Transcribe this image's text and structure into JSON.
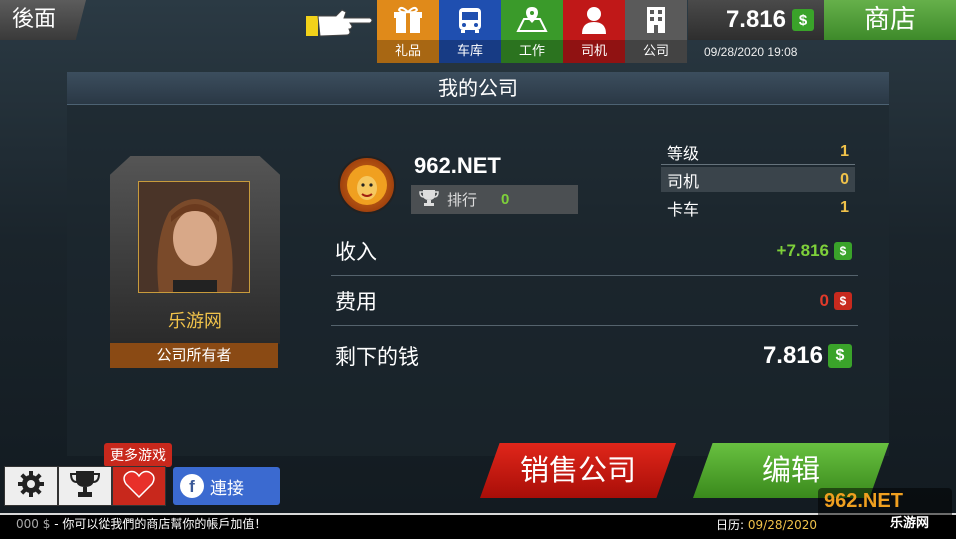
{
  "header": {
    "back_label": "後面",
    "tabs": [
      {
        "label": "礼品",
        "icon": "gift-icon",
        "color": "#e08a1a"
      },
      {
        "label": "车库",
        "icon": "bus-icon",
        "color": "#1f4fb0"
      },
      {
        "label": "工作",
        "icon": "map-icon",
        "color": "#3a9a2a"
      },
      {
        "label": "司机",
        "icon": "driver-icon",
        "color": "#c01818"
      },
      {
        "label": "公司",
        "icon": "building-icon",
        "color": "#5a5a5a"
      }
    ],
    "money": "7.816",
    "shop_label": "商店",
    "datetime": "09/28/2020 19:08"
  },
  "company": {
    "panel_title": "我的公司",
    "name": "962.NET",
    "rank_label": "排行",
    "rank_value": "0",
    "owner_name": "乐游网",
    "owner_role": "公司所有者",
    "stats": [
      {
        "label": "等级",
        "value": "1"
      },
      {
        "label": "司机",
        "value": "0"
      },
      {
        "label": "卡车",
        "value": "1"
      }
    ],
    "finance": [
      {
        "label": "收入",
        "value": "+7.816",
        "color": "#7ed03a",
        "currency_color": "#3aa32a"
      },
      {
        "label": "费用",
        "value": "0",
        "color": "#e03a2a",
        "currency_color": "#c82a1e"
      },
      {
        "label": "剩下的钱",
        "value": "7.816",
        "color": "#ffffff",
        "currency_color": "#3aa32a"
      }
    ]
  },
  "footer": {
    "more_games": "更多游戏",
    "connect_label": "連接",
    "sell_label": "销售公司",
    "edit_label": "编辑",
    "ticker_text": "- 你可以從我們的商店幫你的帳戶加值！",
    "ticker_prefix": "000 $",
    "calendar_label": "日历:",
    "calendar_date": "09/28/2020",
    "watermark_top": "962.NET",
    "watermark_bottom": "乐游网"
  }
}
